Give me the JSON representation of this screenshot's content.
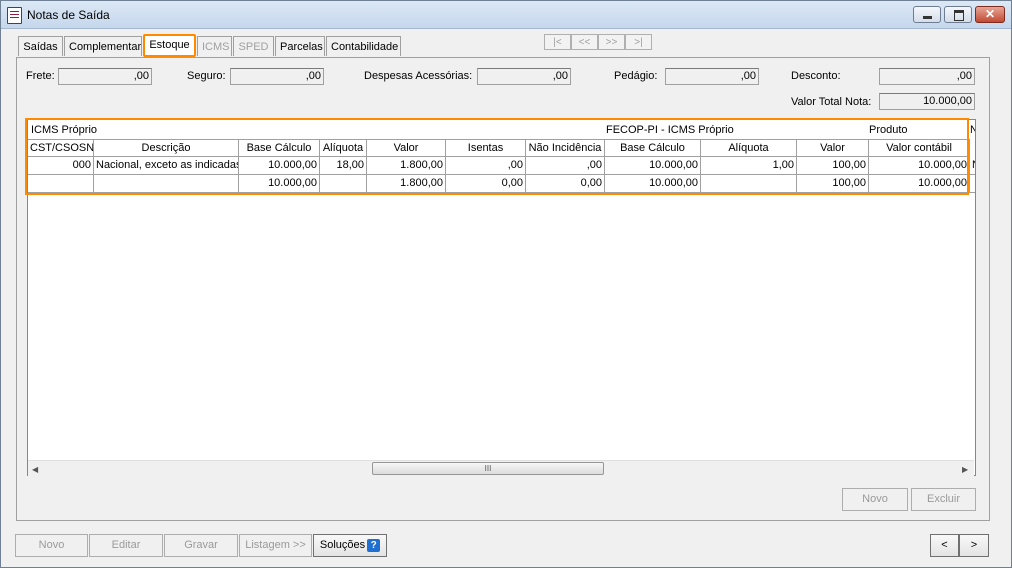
{
  "window": {
    "title": "Notas de Saída"
  },
  "tabs": [
    {
      "label": "Saídas",
      "state": "normal"
    },
    {
      "label": "Complementar",
      "state": "normal"
    },
    {
      "label": "Estoque",
      "state": "active"
    },
    {
      "label": "ICMS",
      "state": "disabled"
    },
    {
      "label": "SPED",
      "state": "disabled"
    },
    {
      "label": "Parcelas",
      "state": "normal"
    },
    {
      "label": "Contabilidade",
      "state": "normal"
    }
  ],
  "record_nav": {
    "first": "|<",
    "prev": "<<",
    "next": ">>",
    "last": ">|"
  },
  "totals": {
    "frete_label": "Frete:",
    "frete_value": ",00",
    "seguro_label": "Seguro:",
    "seguro_value": ",00",
    "despesas_label": "Despesas Acessórias:",
    "despesas_value": ",00",
    "pedagio_label": "Pedágio:",
    "pedagio_value": ",00",
    "desconto_label": "Desconto:",
    "desconto_value": ",00",
    "valor_total_label": "Valor Total Nota:",
    "valor_total_value": "10.000,00"
  },
  "grid": {
    "groups": {
      "icms_proprio": "ICMS Próprio",
      "fecop": "FECOP-PI - ICMS Próprio",
      "produto": "Produto",
      "next": "N"
    },
    "columns": [
      "CST/CSOSN",
      "Descrição",
      "Base Cálculo",
      "Alíquota",
      "Valor",
      "Isentas",
      "Não Incidência",
      "Base Cálculo",
      "Alíquota",
      "Valor",
      "Valor contábil"
    ],
    "rows": [
      [
        "000",
        "Nacional, exceto as indicadas",
        "10.000,00",
        "18,00",
        "1.800,00",
        ",00",
        ",00",
        "10.000,00",
        "1,00",
        "100,00",
        "10.000,00",
        "N"
      ],
      [
        "",
        "",
        "10.000,00",
        "",
        "1.800,00",
        "0,00",
        "0,00",
        "10.000,00",
        "",
        "100,00",
        "10.000,00",
        ""
      ]
    ],
    "scroll_grip": "III"
  },
  "panel_buttons": {
    "novo": "Novo",
    "excluir": "Excluir"
  },
  "bottom_buttons": {
    "novo": "Novo",
    "editar": "Editar",
    "gravar": "Gravar",
    "listagem": "Listagem >>",
    "solucoes": "Soluções",
    "prev": "<",
    "next": ">"
  },
  "colors": {
    "highlight": "#ff8a00",
    "help_icon": "#1f6fd0"
  }
}
